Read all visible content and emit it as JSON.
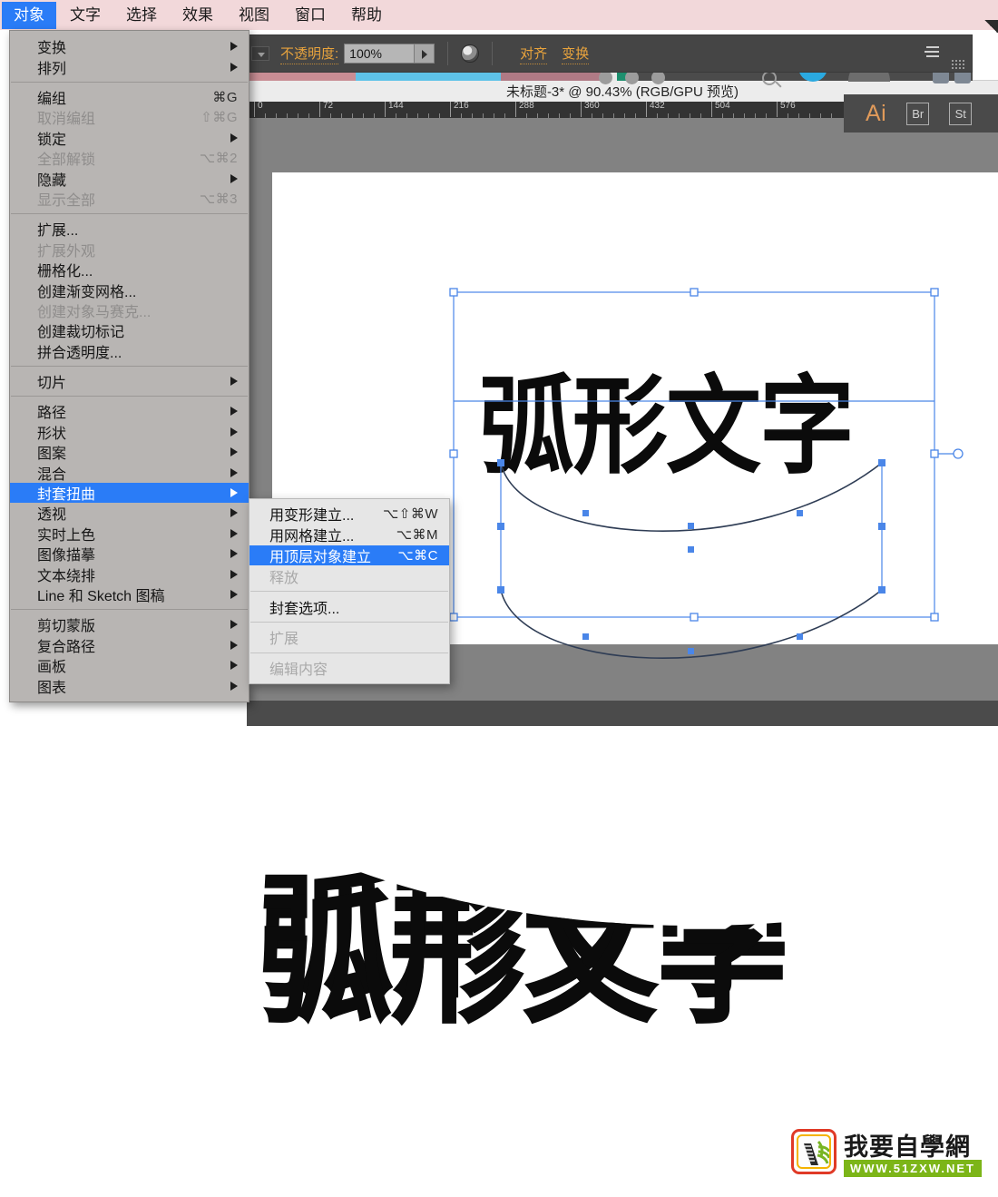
{
  "app": {
    "name": "Adobe Illustrator",
    "document_title": "未标题-3* @ 90.43% (RGB/GPU 预览)"
  },
  "menubar": {
    "items": [
      {
        "label": "对象",
        "active": true
      },
      {
        "label": "文字",
        "active": false
      },
      {
        "label": "选择",
        "active": false
      },
      {
        "label": "效果",
        "active": false
      },
      {
        "label": "视图",
        "active": false
      },
      {
        "label": "窗口",
        "active": false
      },
      {
        "label": "帮助",
        "active": false
      }
    ]
  },
  "control_bar": {
    "opacity_label": "不透明度:",
    "opacity_value": "100%",
    "align_label": "对齐",
    "transform_label": "变换",
    "panel_menu_icon": "panel-menu-icon",
    "color_strip": [
      "#c98d94",
      "#5ec2e8",
      "#b07a85",
      "#e9e9e9",
      "#1d8f6e",
      "#4b4b4b"
    ]
  },
  "app_strip": {
    "ai_label": "Ai",
    "br_label": "Br",
    "st_label": "St"
  },
  "ruler": {
    "ticks": [
      "0",
      "72",
      "144",
      "216",
      "288",
      "360",
      "432",
      "504",
      "576"
    ],
    "unit_spacing_px": 72
  },
  "canvas": {
    "artwork_text": "弧形文字",
    "selection_color": "#4a86e8",
    "envelope_shape": "arc-lower-envelope-path"
  },
  "object_menu": {
    "groups": [
      [
        {
          "label": "变换",
          "shortcut": "",
          "submenu": true,
          "disabled": false,
          "selected": false
        },
        {
          "label": "排列",
          "shortcut": "",
          "submenu": true,
          "disabled": false,
          "selected": false
        }
      ],
      [
        {
          "label": "编组",
          "shortcut": "⌘G",
          "submenu": false,
          "disabled": false,
          "selected": false
        },
        {
          "label": "取消编组",
          "shortcut": "⇧⌘G",
          "submenu": false,
          "disabled": true,
          "selected": false
        },
        {
          "label": "锁定",
          "shortcut": "",
          "submenu": true,
          "disabled": false,
          "selected": false
        },
        {
          "label": "全部解锁",
          "shortcut": "⌥⌘2",
          "submenu": false,
          "disabled": true,
          "selected": false
        },
        {
          "label": "隐藏",
          "shortcut": "",
          "submenu": true,
          "disabled": false,
          "selected": false
        },
        {
          "label": "显示全部",
          "shortcut": "⌥⌘3",
          "submenu": false,
          "disabled": true,
          "selected": false
        }
      ],
      [
        {
          "label": "扩展...",
          "shortcut": "",
          "submenu": false,
          "disabled": false,
          "selected": false
        },
        {
          "label": "扩展外观",
          "shortcut": "",
          "submenu": false,
          "disabled": true,
          "selected": false
        },
        {
          "label": "栅格化...",
          "shortcut": "",
          "submenu": false,
          "disabled": false,
          "selected": false
        },
        {
          "label": "创建渐变网格...",
          "shortcut": "",
          "submenu": false,
          "disabled": false,
          "selected": false
        },
        {
          "label": "创建对象马赛克...",
          "shortcut": "",
          "submenu": false,
          "disabled": true,
          "selected": false
        },
        {
          "label": "创建裁切标记",
          "shortcut": "",
          "submenu": false,
          "disabled": false,
          "selected": false
        },
        {
          "label": "拼合透明度...",
          "shortcut": "",
          "submenu": false,
          "disabled": false,
          "selected": false
        }
      ],
      [
        {
          "label": "切片",
          "shortcut": "",
          "submenu": true,
          "disabled": false,
          "selected": false
        }
      ],
      [
        {
          "label": "路径",
          "shortcut": "",
          "submenu": true,
          "disabled": false,
          "selected": false
        },
        {
          "label": "形状",
          "shortcut": "",
          "submenu": true,
          "disabled": false,
          "selected": false
        },
        {
          "label": "图案",
          "shortcut": "",
          "submenu": true,
          "disabled": false,
          "selected": false
        },
        {
          "label": "混合",
          "shortcut": "",
          "submenu": true,
          "disabled": false,
          "selected": false
        },
        {
          "label": "封套扭曲",
          "shortcut": "",
          "submenu": true,
          "disabled": false,
          "selected": true
        },
        {
          "label": "透视",
          "shortcut": "",
          "submenu": true,
          "disabled": false,
          "selected": false
        },
        {
          "label": "实时上色",
          "shortcut": "",
          "submenu": true,
          "disabled": false,
          "selected": false
        },
        {
          "label": "图像描摹",
          "shortcut": "",
          "submenu": true,
          "disabled": false,
          "selected": false
        },
        {
          "label": "文本绕排",
          "shortcut": "",
          "submenu": true,
          "disabled": false,
          "selected": false
        },
        {
          "label": "Line 和 Sketch 图稿",
          "shortcut": "",
          "submenu": true,
          "disabled": false,
          "selected": false
        }
      ],
      [
        {
          "label": "剪切蒙版",
          "shortcut": "",
          "submenu": true,
          "disabled": false,
          "selected": false
        },
        {
          "label": "复合路径",
          "shortcut": "",
          "submenu": true,
          "disabled": false,
          "selected": false
        },
        {
          "label": "画板",
          "shortcut": "",
          "submenu": true,
          "disabled": false,
          "selected": false
        },
        {
          "label": "图表",
          "shortcut": "",
          "submenu": true,
          "disabled": false,
          "selected": false
        }
      ]
    ]
  },
  "envelope_submenu": {
    "groups": [
      [
        {
          "label": "用变形建立...",
          "shortcut": "⌥⇧⌘W",
          "disabled": false,
          "selected": false
        },
        {
          "label": "用网格建立...",
          "shortcut": "⌥⌘M",
          "disabled": false,
          "selected": false
        },
        {
          "label": "用顶层对象建立",
          "shortcut": "⌥⌘C",
          "disabled": false,
          "selected": true
        },
        {
          "label": "释放",
          "shortcut": "",
          "disabled": true,
          "selected": false
        }
      ],
      [
        {
          "label": "封套选项...",
          "shortcut": "",
          "disabled": false,
          "selected": false
        }
      ],
      [
        {
          "label": "扩展",
          "shortcut": "",
          "disabled": true,
          "selected": false
        }
      ],
      [
        {
          "label": "编辑内容",
          "shortcut": "",
          "disabled": true,
          "selected": false
        }
      ]
    ]
  },
  "result_artwork": {
    "text": "弧形文字",
    "description": "arc-warped-text"
  },
  "watermark": {
    "site_name": "我要自學網",
    "url": "WWW.51ZXW.NET"
  }
}
